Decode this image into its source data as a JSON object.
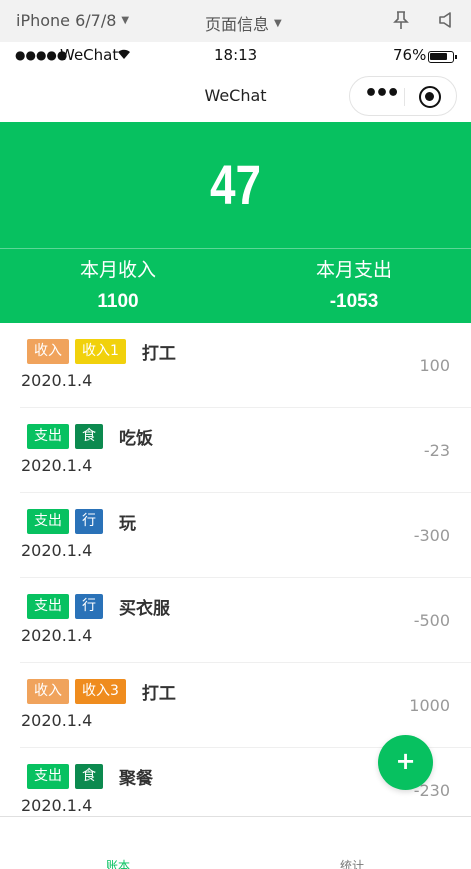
{
  "simulator": {
    "device": "iPhone 6/7/8",
    "page_menu": "页面信息"
  },
  "status_bar": {
    "signal": "●●●●●",
    "carrier": "WeChat",
    "time": "18:13",
    "battery": "76%"
  },
  "nav": {
    "title": "WeChat",
    "menu_dots": "•••"
  },
  "summary": {
    "balance": "47",
    "income_label": "本月收入",
    "income_value": "1100",
    "expense_label": "本月支出",
    "expense_value": "-1053"
  },
  "records": [
    {
      "type": "收入",
      "category": "收入1",
      "title": "打工",
      "date": "2020.1.4",
      "amount": "100"
    },
    {
      "type": "支出",
      "category": "食",
      "title": "吃饭",
      "date": "2020.1.4",
      "amount": "-23"
    },
    {
      "type": "支出",
      "category": "行",
      "title": "玩",
      "date": "2020.1.4",
      "amount": "-300"
    },
    {
      "type": "支出",
      "category": "行",
      "title": "买衣服",
      "date": "2020.1.4",
      "amount": "-500"
    },
    {
      "type": "收入",
      "category": "收入3",
      "title": "打工",
      "date": "2020.1.4",
      "amount": "1000"
    },
    {
      "type": "支出",
      "category": "食",
      "title": "聚餐",
      "date": "2020.1.4",
      "amount": "-230"
    }
  ],
  "fab": {
    "label": "+"
  },
  "tabs": [
    {
      "label": "账本",
      "active": true
    },
    {
      "label": "统计",
      "active": false
    }
  ],
  "colors": {
    "accent": "#07c160",
    "income_tag": "#f0a35c",
    "income1_tag": "#f1d10c",
    "income3_tag": "#ef8c1e",
    "food_tag": "#0c8a4f",
    "travel_tag": "#2a72b8"
  }
}
